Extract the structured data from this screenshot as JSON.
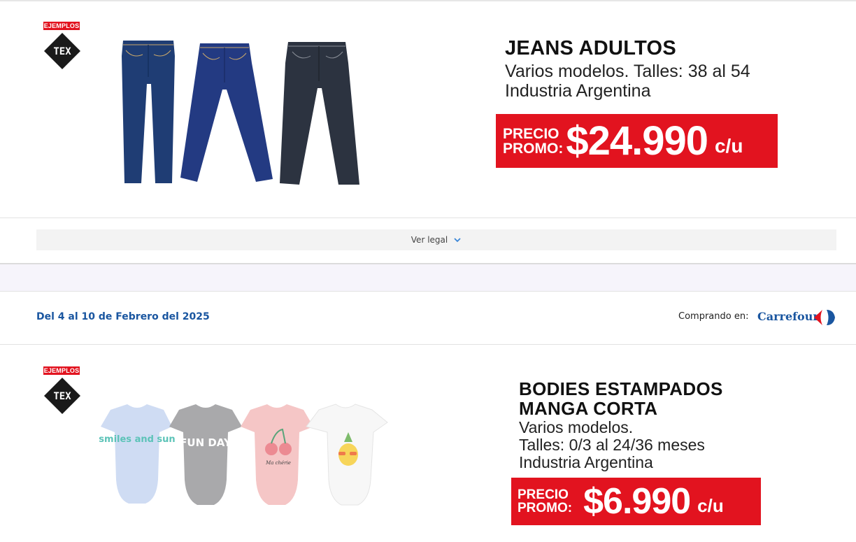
{
  "product1": {
    "badge": "EJEMPLOS",
    "brand_tag": "TEX",
    "title": "JEANS ADULTOS",
    "desc_line1": "Varios modelos. Talles: 38 al 54",
    "desc_line2": "Industria Argentina",
    "price_label_1": "PRECIO",
    "price_label_2": "PROMO:",
    "price": "$24.990",
    "unit": "c/u"
  },
  "legal": {
    "label": "Ver legal"
  },
  "subheader": {
    "date": "Del 4 al 10 de Febrero del 2025",
    "buying_label": "Comprando en:",
    "store": "Carrefour"
  },
  "product2": {
    "badge": "EJEMPLOS",
    "brand_tag": "TEX",
    "title_line1": "BODIES ESTAMPADOS",
    "title_line2": "MANGA CORTA",
    "desc_line1": "Varios modelos.",
    "desc_line2": "Talles: 0/3 al 24/36 meses",
    "desc_line3": "Industria Argentina",
    "price_label_1": "PRECIO",
    "price_label_2": "PROMO:",
    "price": "$6.990",
    "unit": "c/u",
    "body_prints": [
      "smiles and sun",
      "FUN DAY",
      "Ma chérie"
    ]
  },
  "colors": {
    "promo_red": "#e2131f",
    "brand_blue": "#1a56a0",
    "denim_light": "#1f3d74",
    "denim_mid": "#233a82",
    "denim_dark": "#2c3340"
  }
}
